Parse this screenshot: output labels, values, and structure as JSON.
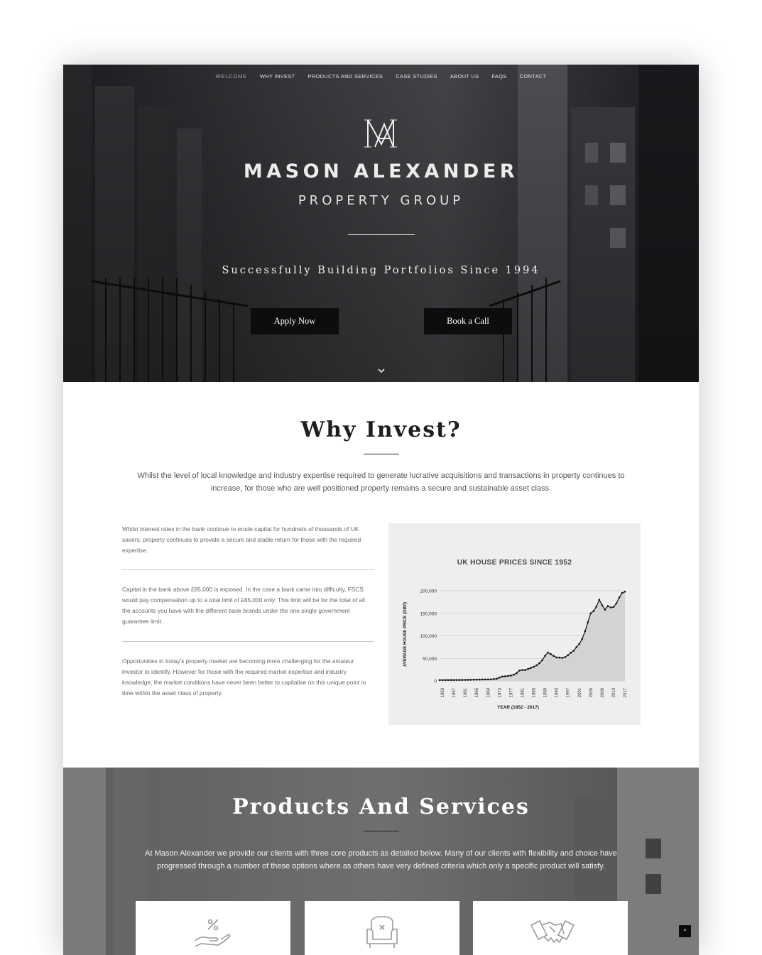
{
  "nav": {
    "items": [
      {
        "label": "WELCOME",
        "active": true
      },
      {
        "label": "WHY INVEST"
      },
      {
        "label": "PRODUCTS AND SERVICES"
      },
      {
        "label": "CASE STUDIES"
      },
      {
        "label": "ABOUT US"
      },
      {
        "label": "FAQS"
      },
      {
        "label": "CONTACT"
      }
    ]
  },
  "hero": {
    "brand_name": "MASON ALEXANDER",
    "brand_sub": "PROPERTY GROUP",
    "tagline": "Successfully Building Portfolios Since 1994",
    "apply_label": "Apply Now",
    "call_label": "Book a Call"
  },
  "why": {
    "title": "Why Invest?",
    "intro": "Whilst the level of local knowledge and industry expertise required to generate lucrative acquisitions and transactions in property continues to increase, for those who are well positioned property remains a secure and sustainable asset class.",
    "paragraphs": [
      "Whilst interest rates in the bank continue to erode capital for hundreds of thousands of UK savers, property continues to provide a secure and stable return for those with the required expertise.",
      "Capital in the bank above £85,000 is exposed. In the case a bank came into difficulty, FSCS would pay compensation up to a total limit of £85,000 only. This limit will be for the total of all the accounts you have with the different bank brands under the one single government guarantee limit.",
      "Opportunities in today's property market are becoming more challenging for the amateur investor to identify. However for those with the required market expertise and industry knowledge, the market conditions have never been better to capitalise on this unique point in time within the asset class of property."
    ]
  },
  "chart_data": {
    "type": "area",
    "title": "UK HOUSE PRICES SINCE 1952",
    "xlabel": "YEAR (1952 - 2017)",
    "ylabel": "AVERAGE HOUSE PRICE (GBP)",
    "ylim": [
      0,
      200000
    ],
    "yticks": [
      "0",
      "50,000",
      "100,000",
      "150,000",
      "200,000"
    ],
    "xticks": [
      "1953",
      "1957",
      "1961",
      "1965",
      "1969",
      "1973",
      "1977",
      "1981",
      "1985",
      "1989",
      "1993",
      "1997",
      "2001",
      "2005",
      "2009",
      "2013",
      "2017"
    ],
    "x": [
      1952,
      1953,
      1954,
      1955,
      1956,
      1957,
      1958,
      1959,
      1960,
      1961,
      1962,
      1963,
      1964,
      1965,
      1966,
      1967,
      1968,
      1969,
      1970,
      1971,
      1972,
      1973,
      1974,
      1975,
      1976,
      1977,
      1978,
      1979,
      1980,
      1981,
      1982,
      1983,
      1984,
      1985,
      1986,
      1987,
      1988,
      1989,
      1990,
      1991,
      1992,
      1993,
      1994,
      1995,
      1996,
      1997,
      1998,
      1999,
      2000,
      2001,
      2002,
      2003,
      2004,
      2005,
      2006,
      2007,
      2008,
      2009,
      2010,
      2011,
      2012,
      2013,
      2014,
      2015,
      2016,
      2017
    ],
    "values": [
      1900,
      1900,
      1950,
      1950,
      2000,
      2050,
      2100,
      2150,
      2200,
      2300,
      2400,
      2550,
      2750,
      2900,
      3050,
      3200,
      3350,
      3450,
      3650,
      4200,
      4800,
      7500,
      9800,
      10400,
      11100,
      11900,
      13800,
      17200,
      23000,
      24400,
      24100,
      26500,
      29000,
      31200,
      34600,
      39400,
      45900,
      56000,
      63000,
      59500,
      55500,
      52000,
      51800,
      51000,
      52700,
      57000,
      62500,
      67000,
      75000,
      82000,
      93000,
      110000,
      130000,
      150000,
      155000,
      165000,
      180000,
      168000,
      158000,
      166000,
      163000,
      164000,
      172000,
      185000,
      195000,
      198000
    ],
    "grid": true,
    "fill": "#d2d3d4",
    "line": "#111111"
  },
  "products": {
    "title": "Products And Services",
    "intro": "At Mason Alexander we provide our clients with three core products as detailed below. Many of our clients with flexibility and choice have progressed through a number of these options where as others have very defined criteria which only a specific product will satisfy.",
    "card_icons": [
      "percent-hand-icon",
      "armchair-icon",
      "handshake-icon"
    ]
  },
  "to_top_glyph": "^"
}
